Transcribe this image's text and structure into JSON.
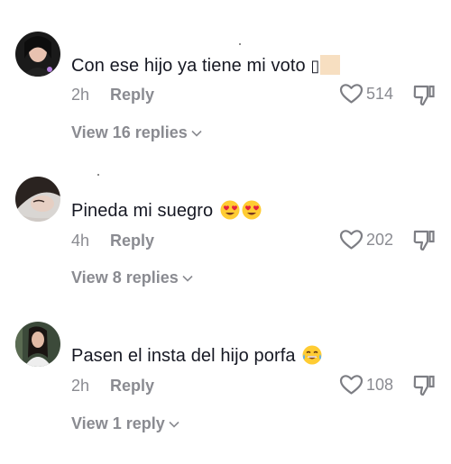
{
  "comments": [
    {
      "text": "Con ese hijo ya tiene mi voto",
      "emoji_glyph": "▯",
      "time": "2h",
      "reply_label": "Reply",
      "likes": "514",
      "view_replies": "View 16 replies"
    },
    {
      "text": "Pineda mi suegro",
      "time": "4h",
      "reply_label": "Reply",
      "likes": "202",
      "view_replies": "View 8 replies"
    },
    {
      "text": "Pasen el insta del hijo porfa",
      "time": "2h",
      "reply_label": "Reply",
      "likes": "108",
      "view_replies": "View 1 reply"
    }
  ],
  "icons": {
    "like": "heart-outline-icon",
    "dislike": "thumbs-down-icon",
    "expand": "chevron-down-icon"
  },
  "colors": {
    "text": "#161823",
    "secondary": "#8a8b91",
    "emoji_face": "#ffcc33",
    "emoji_heart": "#e6243d"
  }
}
